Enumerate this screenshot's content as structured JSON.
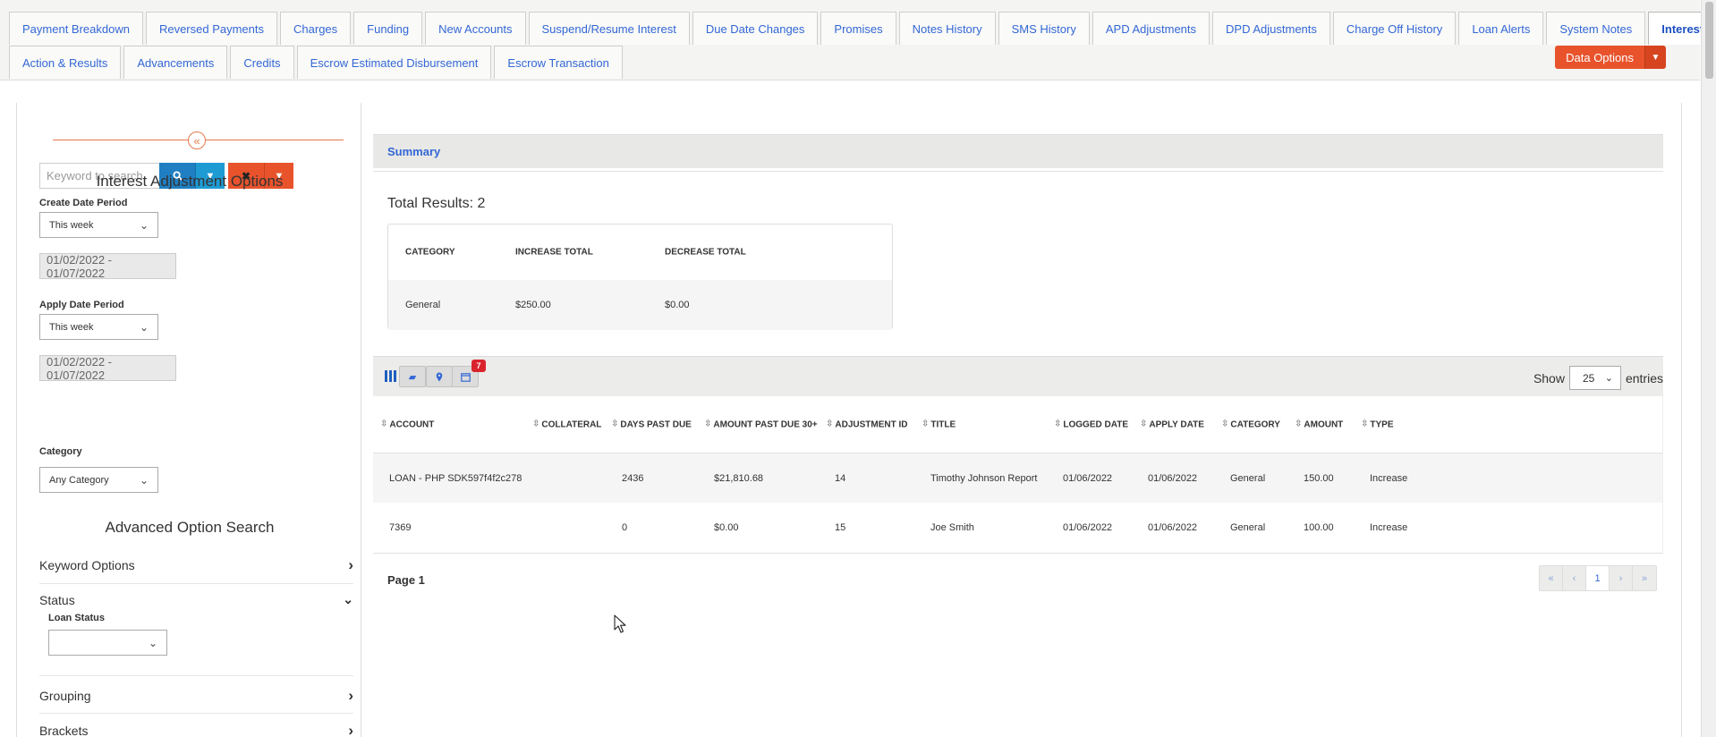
{
  "tabs": {
    "row1": [
      "Payment Breakdown",
      "Reversed Payments",
      "Charges",
      "Funding",
      "New Accounts",
      "Suspend/Resume Interest",
      "Due Date Changes",
      "Promises",
      "Notes History",
      "SMS History",
      "APD Adjustments",
      "DPD Adjustments",
      "Charge Off History",
      "Loan Alerts",
      "System Notes",
      "Interest Adjustment"
    ],
    "row2": [
      "Action & Results",
      "Advancements",
      "Credits",
      "Escrow Estimated Disbursement",
      "Escrow Transaction"
    ],
    "active": "Interest Adjustment",
    "data_options_label": "Data Options"
  },
  "left": {
    "search_placeholder": "Keyword to search",
    "options_heading": "Interest Adjustment Options",
    "create_date": {
      "label": "Create Date Period",
      "selected": "This week",
      "range": "01/02/2022 - 01/07/2022"
    },
    "apply_date": {
      "label": "Apply Date Period",
      "selected": "This week",
      "range": "01/02/2022 - 01/07/2022"
    },
    "category": {
      "label": "Category",
      "selected": "Any Category"
    },
    "advanced_heading": "Advanced Option Search",
    "keyword_options": "Keyword Options",
    "status": {
      "label": "Status",
      "loan_status_label": "Loan Status",
      "loan_status_value": ""
    },
    "grouping": "Grouping",
    "brackets": "Brackets"
  },
  "summary": {
    "title": "Summary",
    "total_results": "Total Results: 2",
    "headers": [
      "CATEGORY",
      "INCREASE TOTAL",
      "DECREASE TOTAL"
    ],
    "row": [
      "General",
      "$250.00",
      "$0.00"
    ]
  },
  "toolbar": {
    "badge_count": "7",
    "show_label": "Show",
    "entries_value": "25",
    "entries_label": "entries"
  },
  "table": {
    "headers": [
      "ACCOUNT",
      "COLLATERAL",
      "DAYS PAST DUE",
      "AMOUNT PAST DUE 30+",
      "ADJUSTMENT ID",
      "TITLE",
      "LOGGED DATE",
      "APPLY DATE",
      "CATEGORY",
      "AMOUNT",
      "TYPE"
    ],
    "rows": [
      [
        "LOAN - PHP SDK597f4f2c278",
        "",
        "2436",
        "$21,810.68",
        "14",
        "Timothy Johnson Report",
        "01/06/2022",
        "01/06/2022",
        "General",
        "150.00",
        "Increase"
      ],
      [
        "7369",
        "",
        "0",
        "$0.00",
        "15",
        "Joe Smith",
        "01/06/2022",
        "01/06/2022",
        "General",
        "100.00",
        "Increase"
      ]
    ]
  },
  "pagination": {
    "page_label": "Page 1",
    "buttons": [
      "«",
      "‹",
      "1",
      "›",
      "»"
    ]
  },
  "colors": {
    "accent_blue": "#3367d6",
    "orange": "#e8532c",
    "search_blue": "#1f7fc2",
    "badge_red": "#d9232d"
  }
}
